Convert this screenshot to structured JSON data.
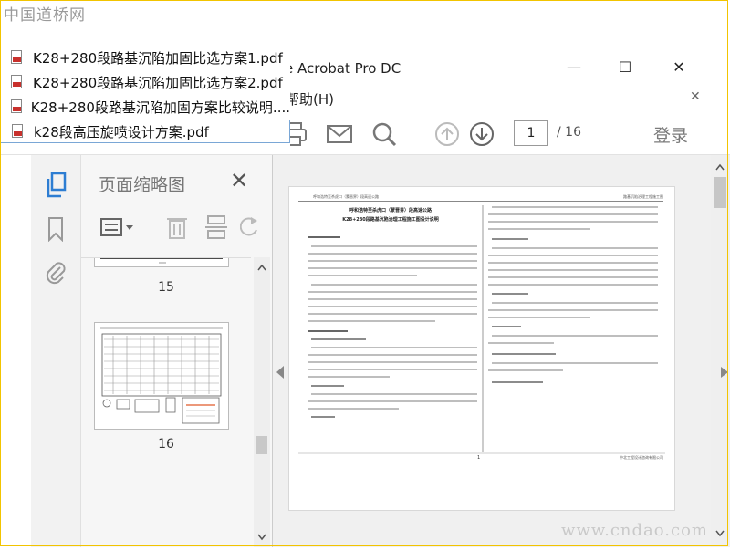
{
  "watermark_top": "中国道桥网",
  "watermark_bottom": "www.cndao.com",
  "window": {
    "title": "e Acrobat Pro DC",
    "minimize": "—",
    "maximize": "☐",
    "close": "✕",
    "menu_help": "帮助(H)",
    "menu_close": "✕"
  },
  "toolbar": {
    "current_page": "1",
    "total_pages": "/ 16",
    "login": "登录"
  },
  "thumbnails": {
    "title": "页面缩略图",
    "close": "✕",
    "pages": [
      {
        "number": "15"
      },
      {
        "number": "16"
      }
    ]
  },
  "recent_files": [
    {
      "name": "K28+280段路基沉陷加固比选方案1.pdf"
    },
    {
      "name": "K28+280段路基沉陷加固比选方案2.pdf"
    },
    {
      "name": "K28+280段路基沉陷加固方案比较说明...."
    },
    {
      "name": "k28段高压旋喷设计方案.pdf"
    }
  ],
  "document": {
    "header_left": "呼和浩特至杀虎口（蒙晋界）段高速公路",
    "header_right": "路基沉陷治理工程施工图",
    "title_line1": "呼和浩特至杀虎口（蒙晋界）段高速公路",
    "title_line2": "K28+280段路基沉陷治理工程施工图设计说明",
    "sections": [
      "一、工程概况",
      "二、地质勘察概况",
      "1、勘察目的与任务",
      "2、勘察方法",
      "(1) 钻探",
      "(2) 原位测试",
      "(3) 室内试验",
      "(4) 数量",
      "3、勘察概况及地层划分",
      "勘察工程量统计表"
    ],
    "page_number": "1",
    "footer_right": "中北工程设计咨询有限公司"
  },
  "colors": {
    "pdf_red": "#c8302c",
    "frame": "#f2c400",
    "selection": "#7aa7d6"
  }
}
